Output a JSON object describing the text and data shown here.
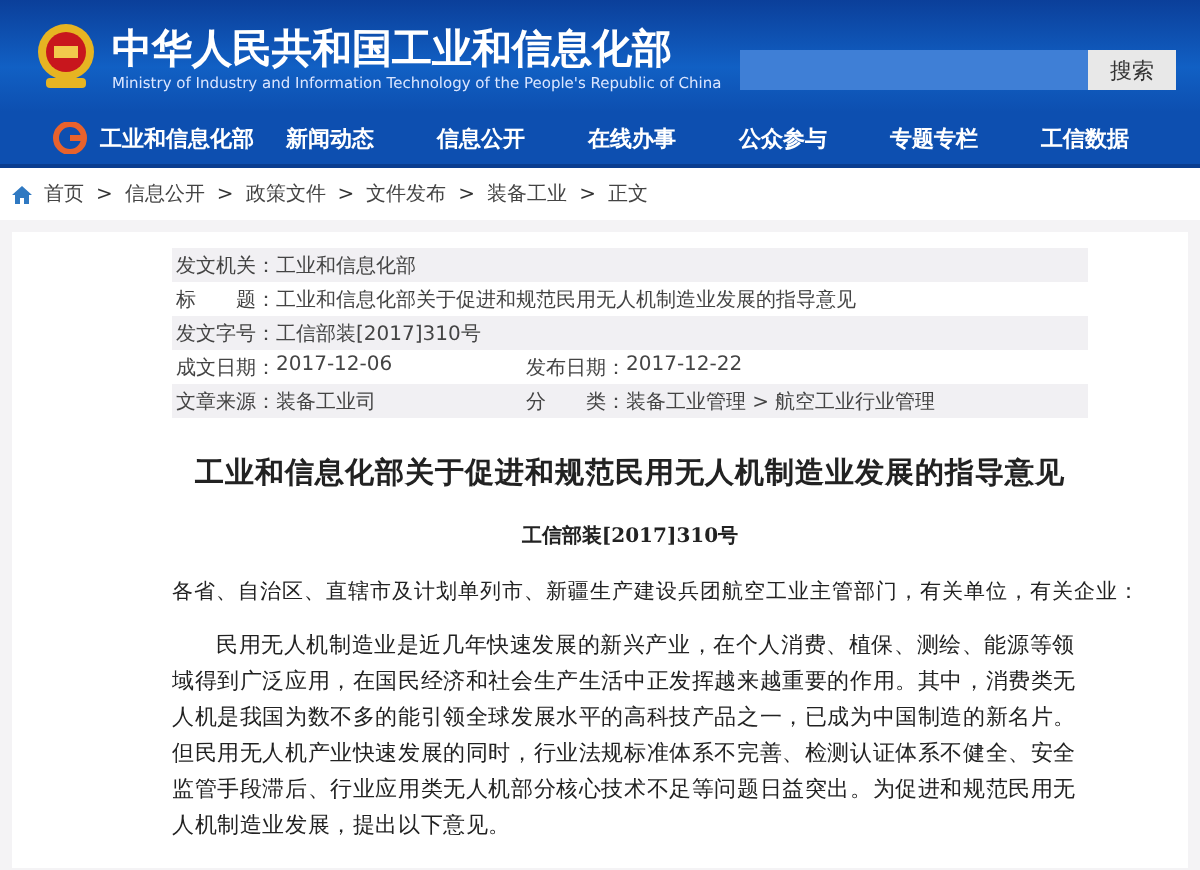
{
  "header": {
    "title": "中华人民共和国工业和信息化部",
    "subtitle": "Ministry of Industry and Information Technology of the People's Republic of China",
    "search_button": "搜索"
  },
  "nav": [
    {
      "label": "工业和信息化部"
    },
    {
      "label": "新闻动态"
    },
    {
      "label": "信息公开"
    },
    {
      "label": "在线办事"
    },
    {
      "label": "公众参与"
    },
    {
      "label": "专题专栏"
    },
    {
      "label": "工信数据"
    }
  ],
  "breadcrumb": {
    "separator": ">",
    "items": [
      "首页",
      "信息公开",
      "政策文件",
      "文件发布",
      "装备工业",
      "正文"
    ]
  },
  "meta": [
    {
      "cells": [
        {
          "label": "发文机关：",
          "value": "工业和信息化部"
        }
      ]
    },
    {
      "cells": [
        {
          "label": "标　　题：",
          "value": "工业和信息化部关于促进和规范民用无人机制造业发展的指导意见"
        }
      ]
    },
    {
      "cells": [
        {
          "label": "发文字号：",
          "value": "工信部装[2017]310号"
        }
      ]
    },
    {
      "cells": [
        {
          "label": "成文日期：",
          "value": "2017-12-06"
        },
        {
          "label": "发布日期：",
          "value": "2017-12-22"
        }
      ]
    },
    {
      "cells": [
        {
          "label": "文章来源：",
          "value": "装备工业司"
        },
        {
          "label": "分　　类：",
          "value": "装备工业管理 > 航空工业行业管理"
        }
      ]
    }
  ],
  "document": {
    "title": "工业和信息化部关于促进和规范民用无人机制造业发展的指导意见",
    "number": "工信部装[2017]310号",
    "greeting": "各省、自治区、直辖市及计划单列市、新疆生产建设兵团航空工业主管部门，有关单位，有关企业：",
    "paragraphs": [
      "民用无人机制造业是近几年快速发展的新兴产业，在个人消费、植保、测绘、能源等领域得到广泛应用，在国民经济和社会生产生活中正发挥越来越重要的作用。其中，消费类无人机是我国为数不多的能引领全球发展水平的高科技产品之一，已成为中国制造的新名片。但民用无人机产业快速发展的同时，行业法规标准体系不完善、检测认证体系不健全、安全监管手段滞后、行业应用类无人机部分核心技术不足等问题日益突出。为促进和规范民用无人机制造业发展，提出以下意见。"
    ]
  }
}
